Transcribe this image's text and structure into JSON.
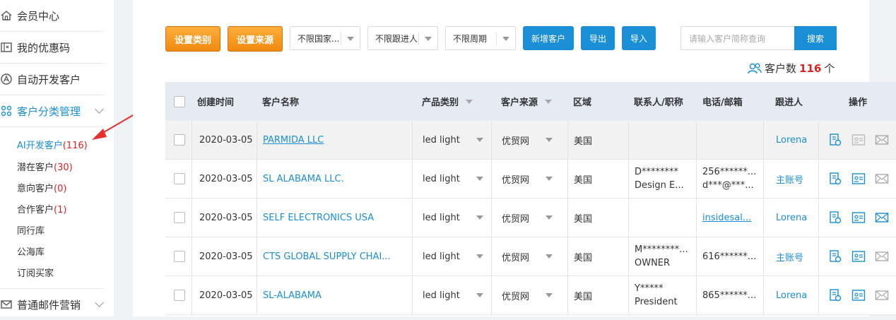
{
  "sidebar": {
    "items": [
      {
        "label": "会员中心",
        "icon": "home-icon"
      },
      {
        "label": "我的优惠码",
        "icon": "coupon-icon"
      },
      {
        "label": "自动开发客户",
        "icon": "auto-icon"
      },
      {
        "label": "客户分类管理",
        "icon": "category-icon"
      },
      {
        "label": "普通邮件营销",
        "icon": "mail-icon"
      }
    ],
    "sub_items": [
      {
        "label": "AI开发客户",
        "count": "(116)"
      },
      {
        "label": "潜在客户",
        "count": "(30)"
      },
      {
        "label": "意向客户",
        "count": "(0)"
      },
      {
        "label": "合作客户",
        "count": "(1)"
      },
      {
        "label": "同行库",
        "count": ""
      },
      {
        "label": "公海库",
        "count": ""
      },
      {
        "label": "订阅买家",
        "count": ""
      }
    ]
  },
  "toolbar": {
    "set_category": "设置类别",
    "set_source": "设置来源",
    "country_select": "不限国家...",
    "follower_select": "不限跟进人",
    "period_select": "不限周期",
    "new_customer": "新增客户",
    "export": "导出",
    "import": "导入",
    "search_placeholder": "请输入客户简称查询",
    "search_button": "搜索"
  },
  "summary": {
    "label": "客户数",
    "count": "116",
    "unit": "个"
  },
  "table": {
    "headers": {
      "created": "创建时间",
      "name": "客户名称",
      "product": "产品类别",
      "source": "客户来源",
      "region": "区域",
      "contact": "联系人/职称",
      "phone": "电话/邮箱",
      "follower": "跟进人",
      "actions": "操作"
    },
    "rows": [
      {
        "date": "2020-03-05",
        "name": "PARMIDA LLC",
        "product": "led light",
        "source": "优贸网",
        "region": "美国",
        "contact1": "",
        "contact2": "",
        "phone1": "",
        "phone2": "",
        "follower": "Lorena"
      },
      {
        "date": "2020-03-05",
        "name": "SL ALABAMA LLC.",
        "product": "led light",
        "source": "优贸网",
        "region": "美国",
        "contact1": "D********",
        "contact2": "Design E...",
        "phone1": "256******...",
        "phone2": "d***@***...",
        "follower": "主账号"
      },
      {
        "date": "2020-03-05",
        "name": "SELF ELECTRONICS USA",
        "product": "led light",
        "source": "优贸网",
        "region": "美国",
        "contact1": "",
        "contact2": "",
        "phone1": "",
        "phone2": "insidesal...",
        "follower": "Lorena"
      },
      {
        "date": "2020-03-05",
        "name": "CTS GLOBAL SUPPLY CHAI...",
        "product": "led light",
        "source": "优贸网",
        "region": "美国",
        "contact1": "M********...",
        "contact2": "OWNER",
        "phone1": "616******...",
        "phone2": "",
        "follower": "主账号"
      },
      {
        "date": "2020-03-05",
        "name": "SL-ALABAMA",
        "product": "led light",
        "source": "优贸网",
        "region": "美国",
        "contact1": "Y*****",
        "contact2": "President",
        "phone1": "865******...",
        "phone2": "",
        "follower": "Lorena"
      }
    ]
  },
  "colors": {
    "accent": "#1a8fd6",
    "orange": "#f39518",
    "count_red": "#e02020"
  }
}
